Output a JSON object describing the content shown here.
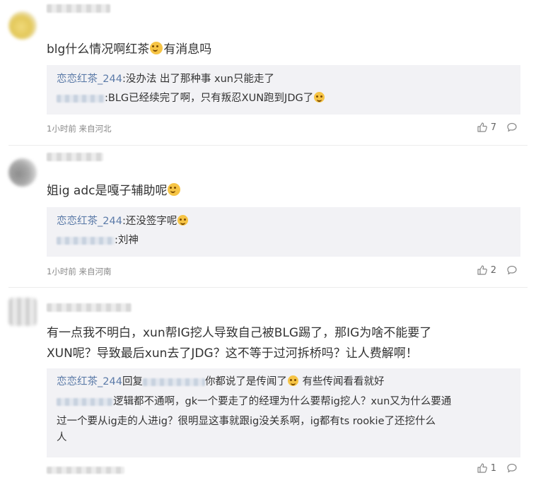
{
  "comments": [
    {
      "text": "blg什么情况啊红茶",
      "text_suffix": "有消息吗",
      "replies": [
        {
          "name": "恋恋红茶_244",
          "text": ":没办法 出了那种事 xun只能走了"
        },
        {
          "text": ":BLG已经续完了啊，只有叛忍XUN跑到JDG了"
        }
      ],
      "meta": "1小时前 来自河北",
      "likes": "7"
    },
    {
      "text": "姐ig adc是嘎子辅助呢",
      "replies": [
        {
          "name": "恋恋红茶_244",
          "text": ":还没签字呢"
        },
        {
          "text": ":刘神"
        }
      ],
      "meta": "1小时前 来自河南",
      "likes": "2"
    },
    {
      "text_line1": "有一点我不明白，xun帮IG挖人导致自己被BLG踢了，那IG为啥不能要了",
      "text_line2": "XUN呢？导致最后xun去了JDG？这不等于过河拆桥吗？让人费解啊！",
      "replies": [
        {
          "name": "恋恋红茶_244",
          "prefix": "回复",
          "text": "你都说了是传闻了",
          "suffix": " 有些传闻看看就好"
        },
        {
          "line1": "逻辑都不通啊，gk一个要走了的经理为什么要帮ig挖人？xun又为什么要通",
          "line2": "过一个要从ig走的人进ig？很明显这事就跟ig没关系啊，ig都有ts rookie了还挖什么",
          "line3": "人"
        }
      ],
      "meta": "",
      "likes": "1"
    }
  ],
  "icons": {
    "like": "thumbs-up-icon",
    "comment": "comment-bubble-icon",
    "emoji": "emoji-icon"
  }
}
